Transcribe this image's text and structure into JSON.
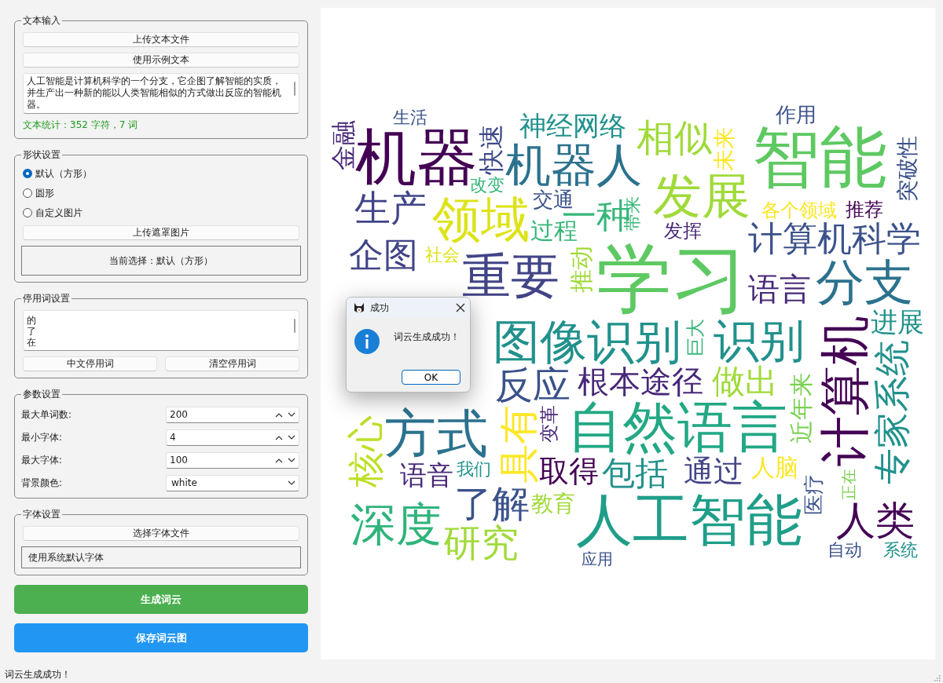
{
  "text_input": {
    "title": "文本输入",
    "buttons": [
      "上传文本文件",
      "使用示例文本"
    ],
    "text": "人工智能是计算机科学的一个分支，它企图了解智能的实质，并生产出一种新的能以人类智能相似的方式做出反应的智能机器。",
    "stats": "文本统计：352 字符，7 词"
  },
  "shape": {
    "title": "形状设置",
    "options": [
      {
        "label": "默认（方形）",
        "selected": true
      },
      {
        "label": "圆形",
        "selected": false
      },
      {
        "label": "自定义图片",
        "selected": false
      }
    ],
    "upload_button": "上传遮罩图片",
    "current": "当前选择：默认（方形）"
  },
  "stopwords": {
    "title": "停用词设置",
    "lines": [
      "的",
      "了",
      "在"
    ],
    "buttons": [
      "中文停用词",
      "清空停用词"
    ]
  },
  "params": {
    "title": "参数设置",
    "fields": [
      {
        "label": "最大单词数:",
        "value": "200",
        "kind": "spinbox"
      },
      {
        "label": "最小字体:",
        "value": "4",
        "kind": "spinbox"
      },
      {
        "label": "最大字体:",
        "value": "100",
        "kind": "spinbox"
      },
      {
        "label": "背景颜色:",
        "value": "white",
        "kind": "dropdown"
      }
    ]
  },
  "font": {
    "title": "字体设置",
    "button": "选择字体文件",
    "current": "使用系统默认字体"
  },
  "generate_button": "生成词云",
  "save_button": "保存词云图",
  "wordcloud": {
    "words": [
      {
        "text": "金融",
        "color": "#482878"
      },
      {
        "text": "生活",
        "color": "#3b528b"
      },
      {
        "text": "机器",
        "color": "#440154"
      },
      {
        "text": "快速",
        "color": "#3e4989"
      },
      {
        "text": "神经网络",
        "color": "#21918c"
      },
      {
        "text": "机器人",
        "color": "#2c728e"
      },
      {
        "text": "相似",
        "color": "#a0da39"
      },
      {
        "text": "发展",
        "color": "#a0da39"
      },
      {
        "text": "未来",
        "color": "#fde725"
      },
      {
        "text": "作用",
        "color": "#3b528b"
      },
      {
        "text": "智能",
        "color": "#5ec962"
      },
      {
        "text": "突破性",
        "color": "#3b528b"
      },
      {
        "text": "生产",
        "color": "#414487"
      },
      {
        "text": "改变",
        "color": "#35b779"
      },
      {
        "text": "领域",
        "color": "#dde318"
      },
      {
        "text": "交通",
        "color": "#3b528b"
      },
      {
        "text": "过程",
        "color": "#35b779"
      },
      {
        "text": "一种",
        "color": "#35b779"
      },
      {
        "text": "带来",
        "color": "#35b779"
      },
      {
        "text": "发挥",
        "color": "#482878"
      },
      {
        "text": "各个领域",
        "color": "#fde725"
      },
      {
        "text": "推荐",
        "color": "#440154"
      },
      {
        "text": "计算机科学",
        "color": "#3b528b"
      },
      {
        "text": "企图",
        "color": "#414487"
      },
      {
        "text": "社会",
        "color": "#dde318"
      },
      {
        "text": "重要",
        "color": "#414487"
      },
      {
        "text": "推动",
        "color": "#a0da39"
      },
      {
        "text": "学习",
        "color": "#5ec962"
      },
      {
        "text": "语言",
        "color": "#482878"
      },
      {
        "text": "分支",
        "color": "#2c728e"
      },
      {
        "text": "图像识别",
        "color": "#21918c"
      },
      {
        "text": "巨大",
        "color": "#35b779"
      },
      {
        "text": "识别",
        "color": "#21918c"
      },
      {
        "text": "进展",
        "color": "#21918c"
      },
      {
        "text": "反应",
        "color": "#3b528b"
      },
      {
        "text": "根本途径",
        "color": "#482878"
      },
      {
        "text": "做出",
        "color": "#a0da39"
      },
      {
        "text": "近年来",
        "color": "#7ad151"
      },
      {
        "text": "计算机",
        "color": "#440154"
      },
      {
        "text": "专家系统",
        "color": "#21918c"
      },
      {
        "text": "核心",
        "color": "#bddf26"
      },
      {
        "text": "方式",
        "color": "#2c728e"
      },
      {
        "text": "具有",
        "color": "#fde725"
      },
      {
        "text": "变革",
        "color": "#482878"
      },
      {
        "text": "自然语言",
        "color": "#22a884"
      },
      {
        "text": "语音",
        "color": "#482878"
      },
      {
        "text": "我们",
        "color": "#21918c"
      },
      {
        "text": "取得",
        "color": "#440154"
      },
      {
        "text": "包括",
        "color": "#21918c"
      },
      {
        "text": "通过",
        "color": "#414487"
      },
      {
        "text": "人脑",
        "color": "#fde725"
      },
      {
        "text": "了解",
        "color": "#3b528b"
      },
      {
        "text": "深度",
        "color": "#2fb47c"
      },
      {
        "text": "研究",
        "color": "#a0da39"
      },
      {
        "text": "教育",
        "color": "#a0da39"
      },
      {
        "text": "人工智能",
        "color": "#1f9e89"
      },
      {
        "text": "应用",
        "color": "#3b528b"
      },
      {
        "text": "医疗",
        "color": "#3b528b"
      },
      {
        "text": "正在",
        "color": "#7ad151"
      },
      {
        "text": "人类",
        "color": "#440154"
      },
      {
        "text": "自动",
        "color": "#3b528b"
      },
      {
        "text": "系统",
        "color": "#21918c"
      }
    ]
  },
  "dialog": {
    "title": "成功",
    "message": "词云生成成功！",
    "button": "OK"
  },
  "status_bar": "词云生成成功！"
}
